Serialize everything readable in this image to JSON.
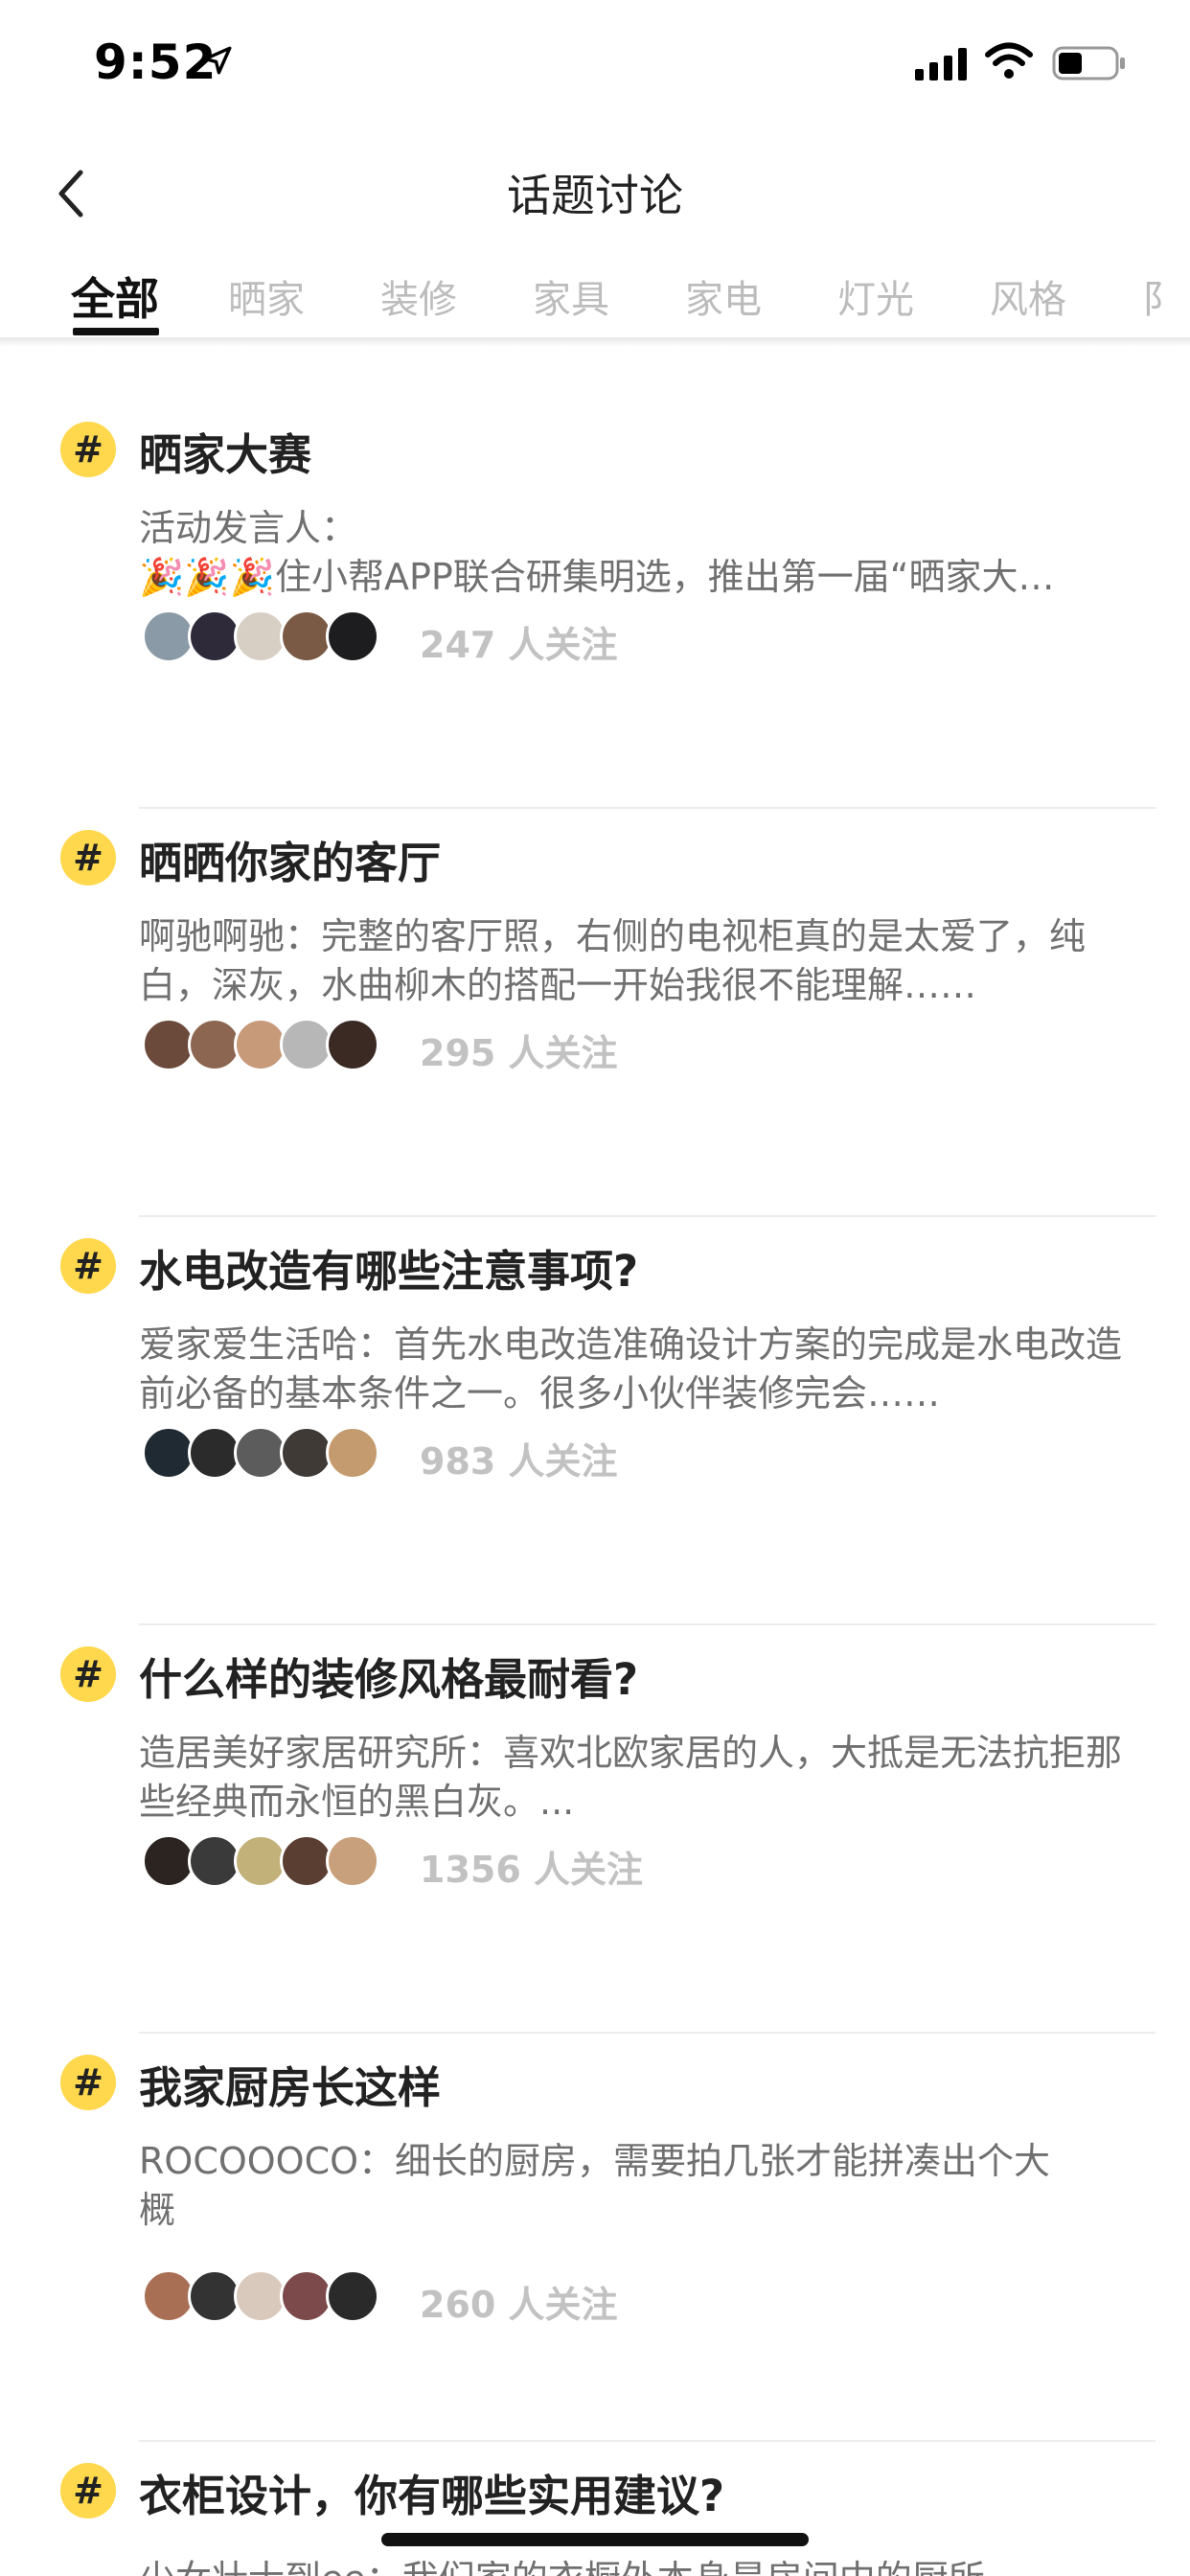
{
  "status_bar": {
    "time": "9:52"
  },
  "nav": {
    "title": "话题讨论"
  },
  "tabs": [
    {
      "label": "全部",
      "active": true
    },
    {
      "label": "晒家"
    },
    {
      "label": "装修"
    },
    {
      "label": "家具"
    },
    {
      "label": "家电"
    },
    {
      "label": "灯光"
    },
    {
      "label": "风格"
    },
    {
      "label": "阝"
    }
  ],
  "topics": [
    {
      "title": "晒家大赛",
      "summary": "活动发言人：\n🎉🎉🎉住小帮APP联合研集明选，推出第一届“晒家大赛”……",
      "followers": "247 人关注"
    },
    {
      "title": "晒晒你家的客厅",
      "summary": "啊驰啊驰：完整的客厅照，右侧的电视柜真的是太爱了，纯白，深灰，水曲柳木的搭配一开始我很不能理解……",
      "followers": "295 人关注"
    },
    {
      "title": "水电改造有哪些注意事项?",
      "summary": "爱家爱生活哈：首先水电改造准确设计方案的完成是水电改造前必备的基本条件之一。很多小伙伴装修完会……",
      "followers": "983 人关注"
    },
    {
      "title": "什么样的装修风格最耐看?",
      "summary": "造居美好家居研究所：喜欢北欧家居的人，大抵是无法抗拒那些经典而永恒的黑白灰。...",
      "followers": "1356 人关注"
    },
    {
      "title": "我家厨房长这样",
      "summary": "ROCOOOCO：细长的厨房，需要拍几张才能拼凑出个大概",
      "followers": "260 人关注"
    },
    {
      "title": "衣柜设计，你有哪些实用建议?",
      "summary": "少女壮士到ee：我们家的衣橱外本身是房间中的厨所",
      "followers": ""
    }
  ],
  "colors": {
    "accent_badge": "#ffd84d",
    "text_primary": "#222222",
    "text_secondary": "#707070",
    "text_muted": "#c2c2c2"
  }
}
